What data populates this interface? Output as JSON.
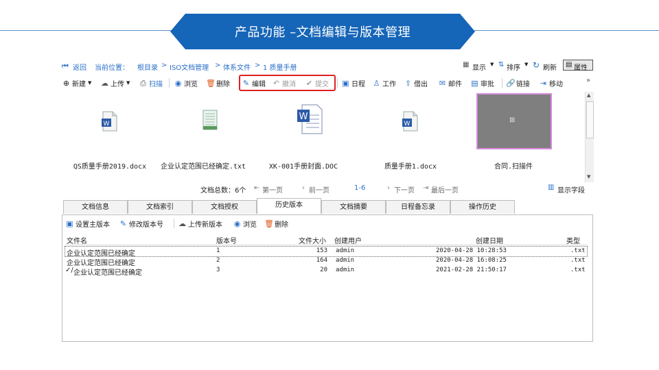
{
  "banner": {
    "title": "产品功能 –文档编辑与版本管理"
  },
  "pathbar": {
    "back": "返回",
    "location_label": "当前位置：",
    "crumbs": [
      "根目录",
      ">",
      "ISO文档管理",
      ">",
      "体系文件",
      ">",
      "1 质量手册"
    ],
    "display": "显示",
    "sort": "排序",
    "refresh": "刷新",
    "properties": "属性"
  },
  "toolbar": {
    "new": "新建",
    "upload": "上传",
    "scan": "扫描",
    "browse": "浏览",
    "delete": "删除",
    "edit": "编辑",
    "undo": "撤消",
    "submit": "提交",
    "schedule": "日程",
    "work": "工作",
    "borrow": "借出",
    "mail": "邮件",
    "approve": "审批",
    "link": "链接",
    "move": "移动",
    "more": "»"
  },
  "files": [
    {
      "name": "QS质量手册2019.docx"
    },
    {
      "name": "企业认定范围已经确定.txt"
    },
    {
      "name": "XK-001手册封面.DOC"
    },
    {
      "name": "质量手册1.docx"
    },
    {
      "name": "合同.扫描件"
    }
  ],
  "pager": {
    "total": "文档总数：6个",
    "first": "第一页",
    "prev": "前一页",
    "range": "1-6",
    "next": "下一页",
    "last": "最后一页",
    "show_fields": "显示字段"
  },
  "tabs": [
    "文档信息",
    "文档索引",
    "文档授权",
    "历史版本",
    "文档摘要",
    "日程备忘录",
    "操作历史"
  ],
  "version_toolbar": {
    "set_main": "设置主版本",
    "edit_version": "修改版本号",
    "upload_new": "上传新版本",
    "browse": "浏览",
    "delete": "删除"
  },
  "table": {
    "headers": [
      "文件名",
      "版本号",
      "文件大小",
      "创建用户",
      "创建日期",
      "类型"
    ],
    "rows": [
      {
        "name": "企业认定范围已经确定",
        "version": "1",
        "size": "153",
        "user": "admin",
        "date": "2020-04-28 10:28:53",
        "type": ".txt"
      },
      {
        "name": "企业认定范围已经确定",
        "version": "2",
        "size": "164",
        "user": "admin",
        "date": "2020-04-28 16:08:25",
        "type": ".txt"
      },
      {
        "name": "企业认定范围已经确定",
        "version": "3",
        "size": "20",
        "user": "admin",
        "date": "2021-02-28 21:50:17",
        "type": ".txt",
        "current_mark": "✓/"
      }
    ]
  },
  "colors": {
    "banner": "#1565b8",
    "link": "#2a6fc9",
    "highlight_box": "#e02020"
  }
}
